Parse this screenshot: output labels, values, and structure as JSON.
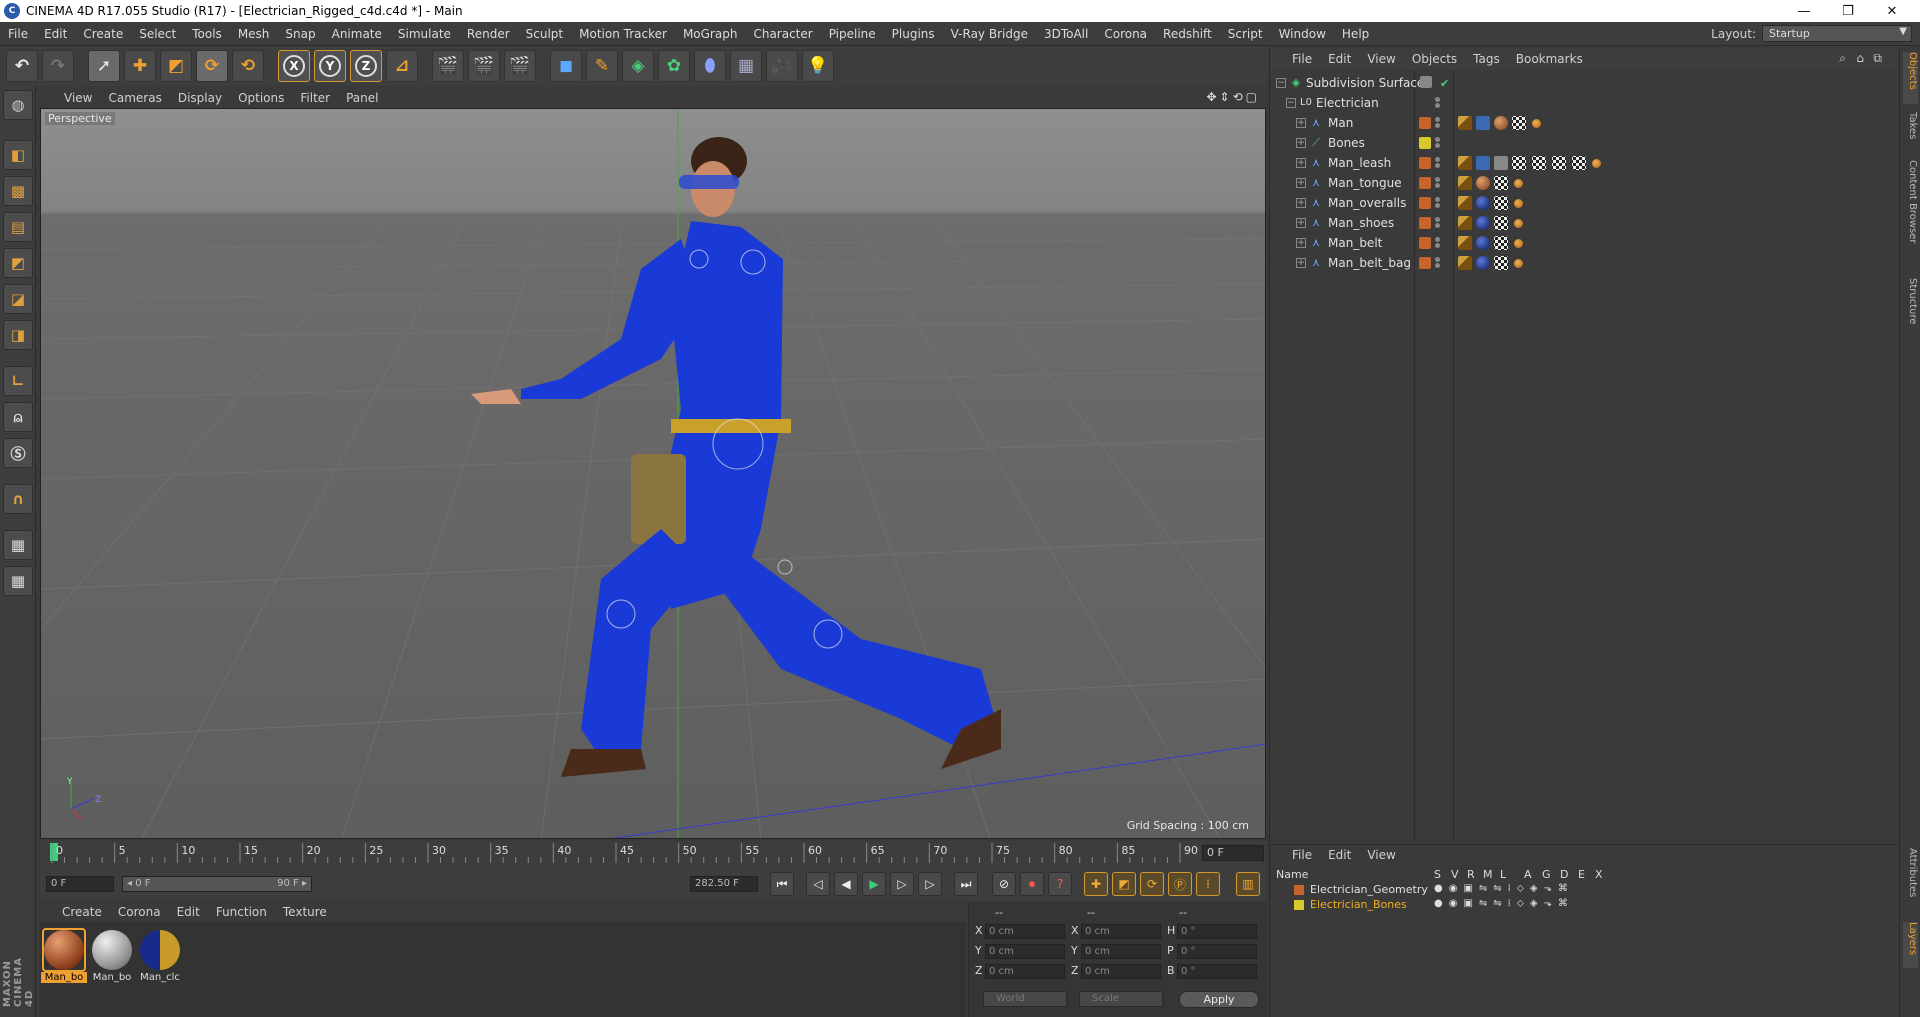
{
  "window": {
    "title": "CINEMA 4D R17.055 Studio (R17) - [Electrician_Rigged_c4d.c4d *] - Main",
    "minimize": "—",
    "maximize": "❐",
    "close": "✕"
  },
  "menubar": {
    "items": [
      "File",
      "Edit",
      "Create",
      "Select",
      "Tools",
      "Mesh",
      "Snap",
      "Animate",
      "Simulate",
      "Render",
      "Sculpt",
      "Motion Tracker",
      "MoGraph",
      "Character",
      "Pipeline",
      "Plugins",
      "V-Ray Bridge",
      "3DToAll",
      "Corona",
      "Redshift",
      "Script",
      "Window",
      "Help"
    ],
    "layout_label": "Layout:",
    "layout_value": "Startup"
  },
  "toolbar": {
    "axis_x": "X",
    "axis_y": "Y",
    "axis_z": "Z"
  },
  "viewport": {
    "menu": [
      "View",
      "Cameras",
      "Display",
      "Options",
      "Filter",
      "Panel"
    ],
    "label": "Perspective",
    "grid_spacing": "Grid Spacing : 100 cm",
    "axis_y": "Y",
    "axis_z": "Z"
  },
  "timeline": {
    "ticks": [
      "0",
      "5",
      "10",
      "15",
      "20",
      "25",
      "30",
      "35",
      "40",
      "45",
      "50",
      "55",
      "60",
      "65",
      "70",
      "75",
      "80",
      "85",
      "90"
    ],
    "current_frame": "0 F"
  },
  "transport": {
    "start_field": "0 F",
    "range_start": "◂ 0 F",
    "range_end": "90 F ▸",
    "end_field": "282.50 F"
  },
  "materials": {
    "menu": [
      "Create",
      "Corona",
      "Edit",
      "Function",
      "Texture"
    ],
    "items": [
      {
        "label": "Man_bo",
        "selected": true
      },
      {
        "label": "Man_bo",
        "selected": false
      },
      {
        "label": "Man_clc",
        "selected": false
      }
    ]
  },
  "coordinates": {
    "header": [
      "--",
      "--",
      "--"
    ],
    "rows": [
      {
        "a": "X",
        "a_val": "0 cm",
        "b": "X",
        "b_val": "0 cm",
        "c": "H",
        "c_val": "0 °"
      },
      {
        "a": "Y",
        "a_val": "0 cm",
        "b": "Y",
        "b_val": "0 cm",
        "c": "P",
        "c_val": "0 °"
      },
      {
        "a": "Z",
        "a_val": "0 cm",
        "b": "Z",
        "b_val": "0 cm",
        "c": "B",
        "c_val": "0 °"
      }
    ],
    "space": "World",
    "mode": "Scale",
    "apply": "Apply"
  },
  "objects": {
    "menu": [
      "File",
      "Edit",
      "View",
      "Objects",
      "Tags",
      "Bookmarks"
    ],
    "rows": [
      {
        "name": "Subdivision Surface",
        "layer": ""
      },
      {
        "name": "Electrician",
        "layer": ""
      },
      {
        "name": "Man",
        "layer": "#c8642a"
      },
      {
        "name": "Bones",
        "layer": "#d8c82a"
      },
      {
        "name": "Man_leash",
        "layer": "#c8642a"
      },
      {
        "name": "Man_tongue",
        "layer": "#c8642a"
      },
      {
        "name": "Man_overalls",
        "layer": "#c8642a"
      },
      {
        "name": "Man_shoes",
        "layer": "#c8642a"
      },
      {
        "name": "Man_belt",
        "layer": "#c8642a"
      },
      {
        "name": "Man_belt_bag",
        "layer": "#c8642a"
      }
    ]
  },
  "side_tabs": [
    "Objects",
    "Takes",
    "Content Browser",
    "Structure",
    "Attributes",
    "Layers"
  ],
  "layers": {
    "menu": [
      "File",
      "Edit",
      "View"
    ],
    "header": {
      "name": "Name",
      "cols": [
        "S",
        "V",
        "R",
        "M",
        "L",
        "A",
        "G",
        "D",
        "E",
        "X"
      ]
    },
    "rows": [
      {
        "name": "Electrician_Geometry",
        "color": "#c8642a"
      },
      {
        "name": "Electrician_Bones",
        "color": "#d8c82a"
      }
    ]
  },
  "maxon_logo": "MAXON CINEMA 4D"
}
